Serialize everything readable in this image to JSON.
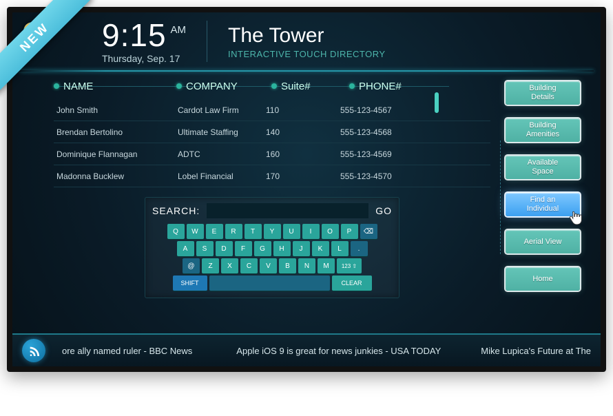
{
  "ribbon": "NEW",
  "header": {
    "time": "9:15",
    "ampm": "AM",
    "date": "Thursday, Sep. 17",
    "title": "The Tower",
    "subtitle": "INTERACTIVE TOUCH DIRECTORY"
  },
  "columns": {
    "name": "NAME",
    "company": "COMPANY",
    "suite": "Suite#",
    "phone": "PHONE#"
  },
  "rows": [
    {
      "name": "John Smith",
      "company": "Cardot Law Firm",
      "suite": "110",
      "phone": "555-123-4567"
    },
    {
      "name": "Brendan Bertolino",
      "company": "Ultimate Staffing",
      "suite": "140",
      "phone": "555-123-4568"
    },
    {
      "name": "Dominique Flannagan",
      "company": "ADTC",
      "suite": "160",
      "phone": "555-123-4569"
    },
    {
      "name": "Madonna Bucklew",
      "company": "Lobel Financial",
      "suite": "170",
      "phone": "555-123-4570"
    }
  ],
  "search": {
    "label": "SEARCH:",
    "go": "GO",
    "placeholder": ""
  },
  "keyboard": {
    "r1": [
      "Q",
      "W",
      "E",
      "R",
      "T",
      "Y",
      "U",
      "I",
      "O",
      "P"
    ],
    "r2": [
      "A",
      "S",
      "D",
      "F",
      "G",
      "H",
      "J",
      "K",
      "L"
    ],
    "r3": [
      "Z",
      "X",
      "C",
      "V",
      "B",
      "N",
      "M"
    ],
    "at": "@",
    "num": "123 ⇧",
    "shift": "SHIFT",
    "clear": "CLEAR",
    "bksp": "⌫",
    "period": "."
  },
  "nav": {
    "details": "Building\nDetails",
    "amenities": "Building\nAmenities",
    "space": "Available\nSpace",
    "find": "Find an\nIndividual",
    "aerial": "Aerial View",
    "home": "Home"
  },
  "ticker": {
    "i0": "ore ally named ruler - BBC News",
    "i1": "Apple iOS 9 is great for news junkies - USA TODAY",
    "i2": "Mike Lupica's Future at The"
  }
}
